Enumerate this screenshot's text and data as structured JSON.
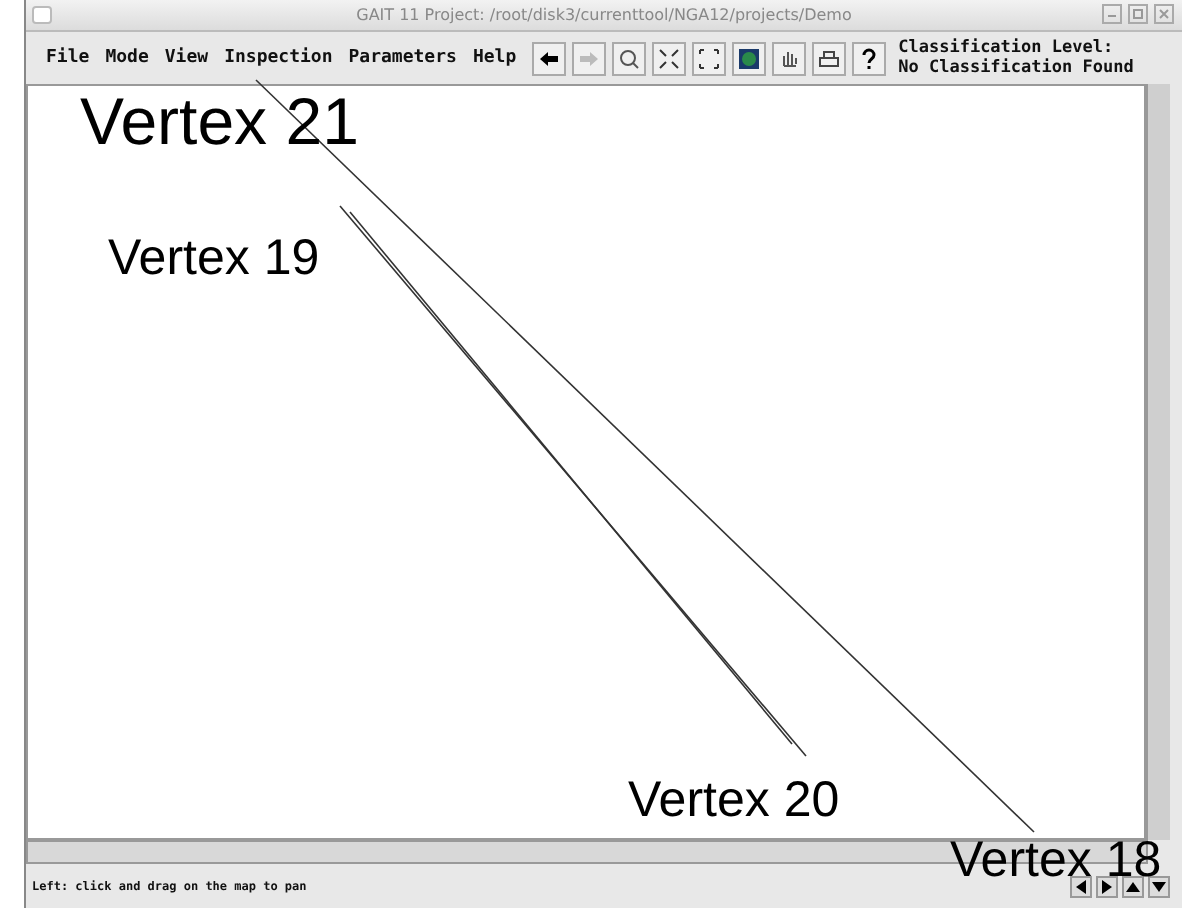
{
  "window": {
    "title": "GAIT 11   Project: /root/disk3/currenttool/NGA12/projects/Demo"
  },
  "menu": [
    "File",
    "Mode",
    "View",
    "Inspection",
    "Parameters",
    "Help"
  ],
  "classification": {
    "label": "Classification Level:",
    "value": "No Classification Found"
  },
  "status_bar": {
    "text": "Left: click and drag on the map to pan"
  },
  "vertices": [
    {
      "label": "Vertex 21",
      "kind": "large"
    },
    {
      "label": "Vertex 19",
      "kind": "small"
    },
    {
      "label": "Vertex 20",
      "kind": "small"
    },
    {
      "label": "Vertex 18",
      "kind": "small"
    }
  ]
}
